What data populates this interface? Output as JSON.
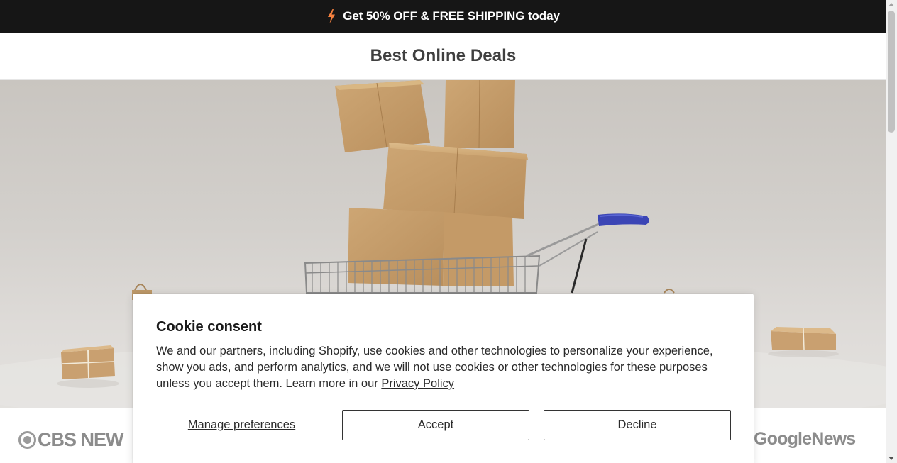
{
  "announcement": {
    "icon": "lightning-bolt-icon",
    "text": "Get 50% OFF & FREE SHIPPING today",
    "accent_color": "#f5813f"
  },
  "header": {
    "brand": "Best Online Deals"
  },
  "hero": {
    "image": "shopping-cart-with-cardboard-boxes-photo"
  },
  "press": {
    "logos": [
      "CBS NEWS",
      "GoogleNews"
    ],
    "cbs_visible": "CBS NEW",
    "gnews_visible": "GoogleNews"
  },
  "cookie_consent": {
    "title": "Cookie consent",
    "body": "We and our partners, including Shopify, use cookies and other technologies to personalize your experience, show you ads, and perform analytics, and we will not use cookies or other technologies for these purposes unless you accept them. Learn more in our ",
    "privacy_link": "Privacy Policy",
    "manage_label": "Manage preferences",
    "accept_label": "Accept",
    "decline_label": "Decline"
  }
}
